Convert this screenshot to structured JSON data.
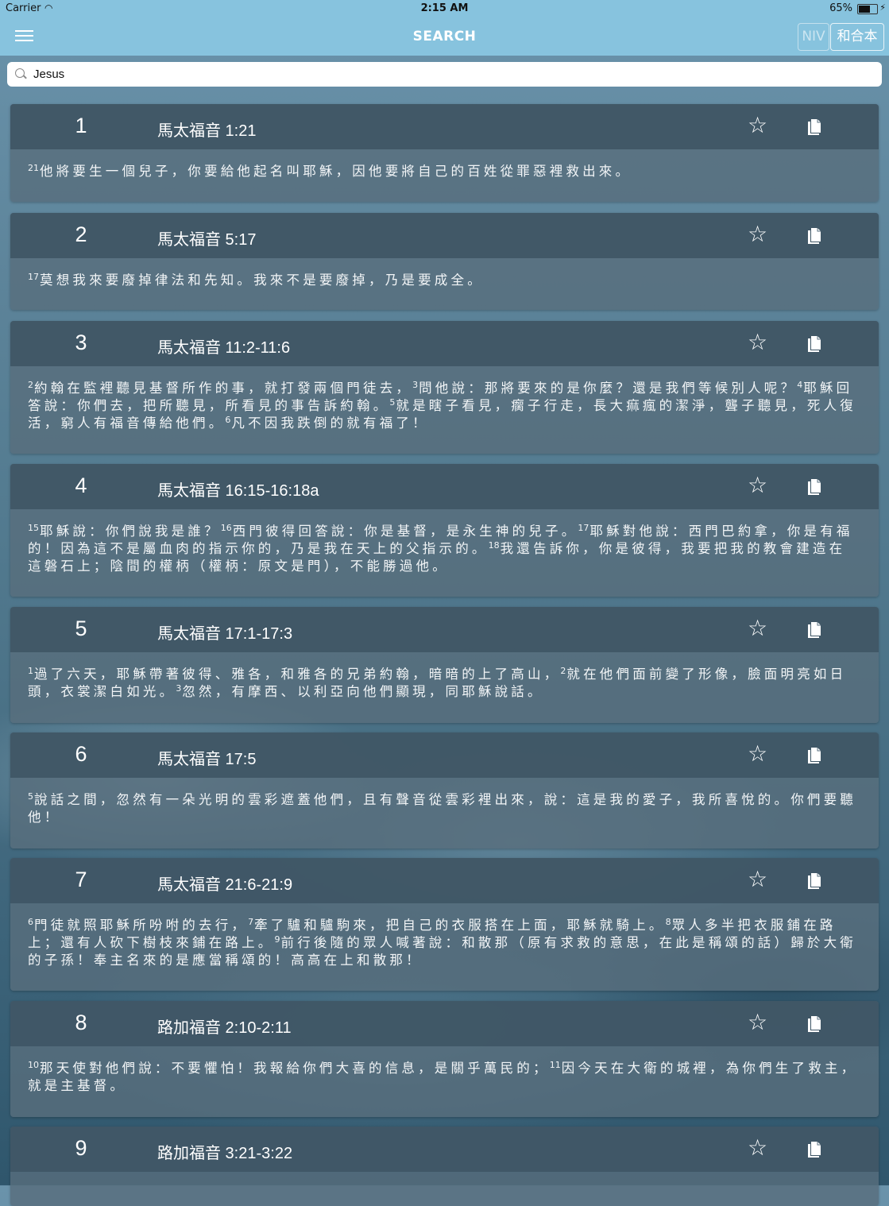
{
  "status_bar": {
    "carrier": "Carrier",
    "time": "2:15 AM",
    "battery_pct": "65%"
  },
  "nav": {
    "title": "SEARCH",
    "version_niv": "NIV",
    "version_cuv": "和合本"
  },
  "search": {
    "value": "Jesus"
  },
  "results": [
    {
      "num": "1",
      "ref": "馬太福音 1:21",
      "segments": [
        {
          "v": "21",
          "t": "他將要生一個兒子，你要給他起名叫耶穌，因他要將自己的百姓從罪惡裡救出來。"
        }
      ]
    },
    {
      "num": "2",
      "ref": "馬太福音 5:17",
      "segments": [
        {
          "v": "17",
          "t": "莫想我來要廢掉律法和先知。我來不是要廢掉，乃是要成全。"
        }
      ]
    },
    {
      "num": "3",
      "ref": "馬太福音 11:2-11:6",
      "segments": [
        {
          "v": "2",
          "t": "約翰在監裡聽見基督所作的事，就打發兩個門徒去，"
        },
        {
          "v": "3",
          "t": "問他說：那將要來的是你麼？還是我們等候別人呢？"
        },
        {
          "v": "4",
          "t": "耶穌回答說：你們去，把所聽見，所看見的事告訴約翰。"
        },
        {
          "v": "5",
          "t": "就是瞎子看見，瘸子行走，長大痲瘋的潔淨，聾子聽見，死人復活，窮人有福音傳給他們。"
        },
        {
          "v": "6",
          "t": "凡不因我跌倒的就有福了！"
        }
      ]
    },
    {
      "num": "4",
      "ref": "馬太福音 16:15-16:18a",
      "segments": [
        {
          "v": "15",
          "t": "耶穌說：你們說我是誰？"
        },
        {
          "v": "16",
          "t": "西門彼得回答說：你是基督，是永生神的兒子。"
        },
        {
          "v": "17",
          "t": "耶穌對他說：西門巴約拿，你是有福的！因為這不是屬血肉的指示你的，乃是我在天上的父指示的。"
        },
        {
          "v": "18",
          "t": "我還告訴你，你是彼得，我要把我的教會建造在這磐石上；陰間的權柄（權柄：原文是門），不能勝過他。"
        }
      ]
    },
    {
      "num": "5",
      "ref": "馬太福音 17:1-17:3",
      "segments": [
        {
          "v": "1",
          "t": "過了六天，耶穌帶著彼得、雅各，和雅各的兄弟約翰，暗暗的上了高山，"
        },
        {
          "v": "2",
          "t": "就在他們面前變了形像，臉面明亮如日頭，衣裳潔白如光。"
        },
        {
          "v": "3",
          "t": "忽然，有摩西、以利亞向他們顯現，同耶穌說話。"
        }
      ]
    },
    {
      "num": "6",
      "ref": "馬太福音 17:5",
      "segments": [
        {
          "v": "5",
          "t": "說話之間，忽然有一朵光明的雲彩遮蓋他們，且有聲音從雲彩裡出來，說：這是我的愛子，我所喜悅的。你們要聽他！"
        }
      ]
    },
    {
      "num": "7",
      "ref": "馬太福音 21:6-21:9",
      "segments": [
        {
          "v": "6",
          "t": "門徒就照耶穌所吩咐的去行，"
        },
        {
          "v": "7",
          "t": "牽了驢和驢駒來，把自己的衣服搭在上面，耶穌就騎上。"
        },
        {
          "v": "8",
          "t": "眾人多半把衣服鋪在路上；還有人砍下樹枝來鋪在路上。"
        },
        {
          "v": "9",
          "t": "前行後隨的眾人喊著說：和散那（原有求救的意思，在此是稱頌的話）歸於大衛的子孫！奉主名來的是應當稱頌的！高高在上和散那！"
        }
      ]
    },
    {
      "num": "8",
      "ref": "路加福音 2:10-2:11",
      "segments": [
        {
          "v": "10",
          "t": "那天使對他們說：不要懼怕！我報給你們大喜的信息，是關乎萬民的；"
        },
        {
          "v": "11",
          "t": "因今天在大衛的城裡，為你們生了救主，就是主基督。"
        }
      ]
    },
    {
      "num": "9",
      "ref": "路加福音 3:21-3:22",
      "segments": []
    }
  ]
}
